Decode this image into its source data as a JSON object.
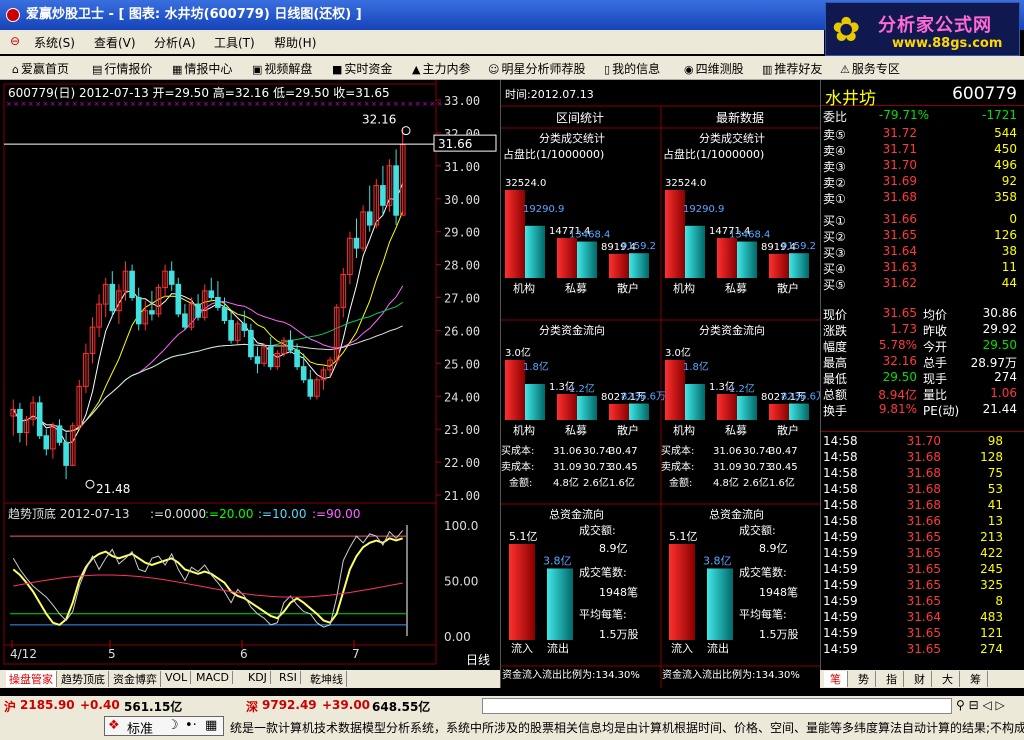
{
  "window": {
    "title": "爱赢炒股卫士 - [ 图表: 水井坊(600779) 日线图(还权) ]"
  },
  "logo": {
    "text": "分析家公式网",
    "url": "www.88gs.com"
  },
  "menu": [
    "系统(S)",
    "查看(V)",
    "分析(A)",
    "工具(T)",
    "帮助(H)"
  ],
  "toolbar": [
    "爱赢首页",
    "行情报价",
    "情报中心",
    "视频解盘",
    "实时资金",
    "主力内参",
    "明星分析师荐股",
    "我的信息",
    "四维测股",
    "推荐好友",
    "服务专区"
  ],
  "chart": {
    "info": "600779(日) 2012-07-13 开=29.50 高=32.16 低=29.50 收=31.65",
    "price_ticks": [
      "33.00",
      "32.00",
      "31.00",
      "30.00",
      "29.00",
      "28.00",
      "27.00",
      "26.00",
      "25.00",
      "24.00",
      "23.00",
      "22.00",
      "21.00"
    ],
    "high_label": "32.16",
    "low_label": "21.48",
    "cursor_price": "31.66",
    "ind_title": "趋势顶底 2012-07-13",
    "ind_v1": ":=0.0000",
    "ind_v2": ":=20.00",
    "ind_v3": ":=10.00",
    "ind_v4": ":=90.00",
    "ind_ticks": [
      "100.0",
      "50.00",
      "0.00"
    ],
    "dates": [
      "4/12",
      "5",
      "6",
      "7"
    ],
    "period": "日线"
  },
  "chart_data": {
    "type": "candlestick",
    "title": "600779(日)",
    "ylim": [
      21,
      33
    ],
    "ohlc": [
      [
        23.4,
        23.9,
        22.8,
        23.6
      ],
      [
        23.6,
        23.8,
        22.6,
        22.9
      ],
      [
        22.9,
        23.4,
        22.5,
        23.3
      ],
      [
        23.3,
        24.0,
        23.1,
        23.8
      ],
      [
        23.8,
        24.0,
        22.7,
        22.8
      ],
      [
        22.8,
        23.0,
        22.2,
        22.4
      ],
      [
        22.4,
        23.2,
        22.1,
        23.1
      ],
      [
        23.1,
        23.3,
        22.5,
        22.6
      ],
      [
        22.6,
        22.9,
        21.48,
        21.9
      ],
      [
        21.9,
        23.2,
        21.9,
        23.1
      ],
      [
        23.1,
        24.5,
        23.0,
        24.3
      ],
      [
        24.3,
        25.6,
        24.1,
        25.3
      ],
      [
        25.3,
        26.4,
        25.0,
        26.1
      ],
      [
        26.1,
        27.1,
        25.8,
        26.8
      ],
      [
        26.8,
        27.6,
        26.4,
        27.4
      ],
      [
        27.4,
        27.8,
        26.4,
        26.6
      ],
      [
        26.6,
        27.4,
        26.2,
        27.2
      ],
      [
        27.2,
        28.1,
        26.9,
        27.8
      ],
      [
        27.8,
        28.0,
        26.9,
        27.0
      ],
      [
        27.0,
        27.3,
        26.0,
        26.2
      ],
      [
        26.2,
        26.9,
        26.0,
        26.6
      ],
      [
        26.6,
        27.2,
        26.3,
        26.5
      ],
      [
        26.5,
        27.4,
        26.4,
        27.3
      ],
      [
        27.3,
        28.0,
        27.0,
        27.8
      ],
      [
        27.8,
        28.1,
        27.2,
        27.4
      ],
      [
        27.4,
        27.6,
        26.4,
        26.5
      ],
      [
        26.5,
        26.8,
        26.0,
        26.1
      ],
      [
        26.1,
        27.0,
        26.0,
        26.8
      ],
      [
        26.8,
        27.1,
        26.3,
        26.4
      ],
      [
        26.4,
        27.4,
        26.3,
        27.2
      ],
      [
        27.2,
        27.6,
        26.9,
        27.0
      ],
      [
        27.0,
        27.5,
        26.6,
        26.7
      ],
      [
        26.7,
        27.0,
        26.2,
        26.3
      ],
      [
        26.3,
        26.6,
        25.6,
        25.7
      ],
      [
        25.7,
        26.3,
        25.6,
        26.2
      ],
      [
        26.2,
        26.6,
        25.8,
        26.0
      ],
      [
        26.0,
        26.2,
        25.1,
        25.2
      ],
      [
        25.2,
        25.5,
        24.7,
        25.0
      ],
      [
        25.0,
        25.6,
        24.9,
        25.5
      ],
      [
        25.5,
        25.8,
        24.8,
        24.9
      ],
      [
        24.9,
        25.4,
        24.8,
        25.3
      ],
      [
        25.3,
        25.8,
        25.2,
        25.7
      ],
      [
        25.7,
        26.0,
        25.3,
        25.4
      ],
      [
        25.4,
        25.6,
        24.8,
        24.9
      ],
      [
        24.9,
        25.3,
        24.4,
        24.5
      ],
      [
        24.5,
        24.8,
        23.9,
        24.0
      ],
      [
        24.0,
        24.6,
        23.9,
        24.5
      ],
      [
        24.5,
        24.9,
        24.2,
        24.8
      ],
      [
        24.8,
        25.2,
        24.6,
        25.1
      ],
      [
        25.1,
        26.8,
        25.0,
        26.7
      ],
      [
        26.7,
        27.9,
        26.4,
        27.7
      ],
      [
        27.7,
        29.0,
        27.4,
        28.8
      ],
      [
        28.8,
        29.4,
        28.2,
        28.5
      ],
      [
        28.5,
        29.8,
        28.4,
        29.6
      ],
      [
        29.6,
        30.4,
        29.0,
        29.2
      ],
      [
        29.2,
        30.6,
        29.1,
        30.4
      ],
      [
        30.4,
        31.0,
        29.5,
        29.8
      ],
      [
        29.8,
        31.2,
        29.6,
        31.0
      ],
      [
        31.0,
        31.5,
        29.2,
        29.5
      ],
      [
        29.5,
        32.16,
        29.5,
        31.65
      ]
    ]
  },
  "mid": {
    "time": "时间:2012.07.13",
    "headers": [
      "区间统计",
      "最新数据"
    ],
    "panels": [
      {
        "title": "分类成交统计",
        "subtitle": "占盘比(1/1000000)",
        "labels": [
          "机构",
          "私募",
          "散户"
        ],
        "red": [
          "32524.0",
          "14771.4",
          "8919.4"
        ],
        "cyan": [
          "19290.9",
          "13468.4",
          "9159.2"
        ],
        "redv": [
          32524,
          14771.4,
          8919.4
        ],
        "cyanv": [
          19290.9,
          13468.4,
          9159.2
        ]
      },
      {
        "title": "分类成交统计",
        "subtitle": "占盘比(1/1000000)",
        "labels": [
          "机构",
          "私募",
          "散户"
        ],
        "red": [
          "32524.0",
          "14771.4",
          "8919.4"
        ],
        "cyan": [
          "19290.9",
          "13468.4",
          "9159.2"
        ],
        "redv": [
          32524,
          14771.4,
          8919.4
        ],
        "cyanv": [
          19290.9,
          13468.4,
          9159.2
        ]
      },
      {
        "title": "分类资金流向",
        "labels": [
          "机构",
          "私募",
          "散户"
        ],
        "red": [
          "3.0亿",
          "1.3亿",
          "8027.1万"
        ],
        "cyan": [
          "1.8亿",
          "1.2亿",
          "8236.6万"
        ],
        "redv": [
          3.0,
          1.3,
          0.80271
        ],
        "cyanv": [
          1.8,
          1.2,
          0.82366
        ],
        "rows": [
          [
            "买成本:",
            "31.06",
            "30.74",
            "30.47"
          ],
          [
            "卖成本:",
            "31.09",
            "30.73",
            "30.45"
          ],
          [
            "金额:",
            "4.8亿",
            "2.6亿",
            "1.6亿"
          ]
        ]
      },
      {
        "title": "分类资金流向",
        "labels": [
          "机构",
          "私募",
          "散户"
        ],
        "red": [
          "3.0亿",
          "1.3亿",
          "8027.1万"
        ],
        "cyan": [
          "1.8亿",
          "1.2亿",
          "8236.6万"
        ],
        "redv": [
          3.0,
          1.3,
          0.80271
        ],
        "cyanv": [
          1.8,
          1.2,
          0.82366
        ],
        "rows": [
          [
            "买成本:",
            "31.06",
            "30.74",
            "30.47"
          ],
          [
            "卖成本:",
            "31.09",
            "30.73",
            "30.45"
          ],
          [
            "金额:",
            "4.8亿",
            "2.6亿",
            "1.6亿"
          ]
        ]
      },
      {
        "title": "总资金流向",
        "in": "5.1亿",
        "out": "3.8亿",
        "inv": 5.1,
        "outv": 3.8,
        "labels": [
          "流入",
          "流出"
        ],
        "t1": "成交额:",
        "v1": "8.9亿",
        "t2": "成交笔数:",
        "v2": "1948笔",
        "t3": "平均每笔:",
        "v3": "1.5万股",
        "ratio": "资金流入流出比例为:134.30%"
      },
      {
        "title": "总资金流向",
        "in": "5.1亿",
        "out": "3.8亿",
        "inv": 5.1,
        "outv": 3.8,
        "labels": [
          "流入",
          "流出"
        ],
        "t1": "成交额:",
        "v1": "8.9亿",
        "t2": "成交笔数:",
        "v2": "1948笔",
        "t3": "平均每笔:",
        "v3": "1.5万股",
        "ratio": "资金流入流出比例为:134.30%"
      }
    ]
  },
  "quote": {
    "name": "水井坊",
    "code": "600779",
    "weibi": {
      "label": "委比",
      "v1": "-79.71%",
      "v2": "-1721"
    },
    "sell": [
      {
        "l": "卖⑤",
        "p": "31.72",
        "v": "544"
      },
      {
        "l": "卖④",
        "p": "31.71",
        "v": "450"
      },
      {
        "l": "卖③",
        "p": "31.70",
        "v": "496"
      },
      {
        "l": "卖②",
        "p": "31.69",
        "v": "92"
      },
      {
        "l": "卖①",
        "p": "31.68",
        "v": "358"
      }
    ],
    "buy": [
      {
        "l": "买①",
        "p": "31.66",
        "v": "0"
      },
      {
        "l": "买②",
        "p": "31.65",
        "v": "126"
      },
      {
        "l": "买③",
        "p": "31.64",
        "v": "38"
      },
      {
        "l": "买④",
        "p": "31.63",
        "v": "11"
      },
      {
        "l": "买⑤",
        "p": "31.62",
        "v": "44"
      }
    ],
    "stats": [
      [
        "现价",
        "31.65",
        "均价",
        "30.86"
      ],
      [
        "涨跌",
        "1.73",
        "昨收",
        "29.92"
      ],
      [
        "幅度",
        "5.78%",
        "今开",
        "29.50"
      ],
      [
        "最高",
        "32.16",
        "总手",
        "28.97万"
      ],
      [
        "最低",
        "29.50",
        "现手",
        "274"
      ],
      [
        "总额",
        "8.94亿",
        "量比",
        "1.06"
      ],
      [
        "换手",
        "9.81%",
        "PE(动)",
        "21.44"
      ]
    ],
    "ticks": [
      [
        "14:58",
        "31.70",
        "98"
      ],
      [
        "14:58",
        "31.68",
        "128"
      ],
      [
        "14:58",
        "31.68",
        "75"
      ],
      [
        "14:58",
        "31.68",
        "53"
      ],
      [
        "14:58",
        "31.68",
        "41"
      ],
      [
        "14:58",
        "31.66",
        "13"
      ],
      [
        "14:59",
        "31.65",
        "213"
      ],
      [
        "14:59",
        "31.65",
        "422"
      ],
      [
        "14:59",
        "31.65",
        "245"
      ],
      [
        "14:59",
        "31.65",
        "325"
      ],
      [
        "14:59",
        "31.65",
        "8"
      ],
      [
        "14:59",
        "31.64",
        "483"
      ],
      [
        "14:59",
        "31.65",
        "121"
      ],
      [
        "14:59",
        "31.65",
        "274"
      ]
    ]
  },
  "tabs_left": [
    "操盘管家",
    "趋势顶底",
    "资金博弈",
    "VOL",
    "MACD",
    "KDJ",
    "RSI",
    "乾坤线"
  ],
  "tabs_right": [
    "笔",
    "势",
    "指",
    "财",
    "大",
    "筹"
  ],
  "status": {
    "sh_label": "沪",
    "sh_idx": "2185.90",
    "sh_chg": "+0.40",
    "sh_amt": "561.15亿",
    "sz_label": "深",
    "sz_idx": "9792.49",
    "sz_chg": "+39.00",
    "sz_amt": "648.55亿"
  },
  "ime": "标准",
  "ticker": "统是一款计算机技术数据模型分析系统，系统中所涉及的股票相关信息均是由计算机根据时间、价格、空间、量能等多纬度算法自动计算的结果;不构成"
}
